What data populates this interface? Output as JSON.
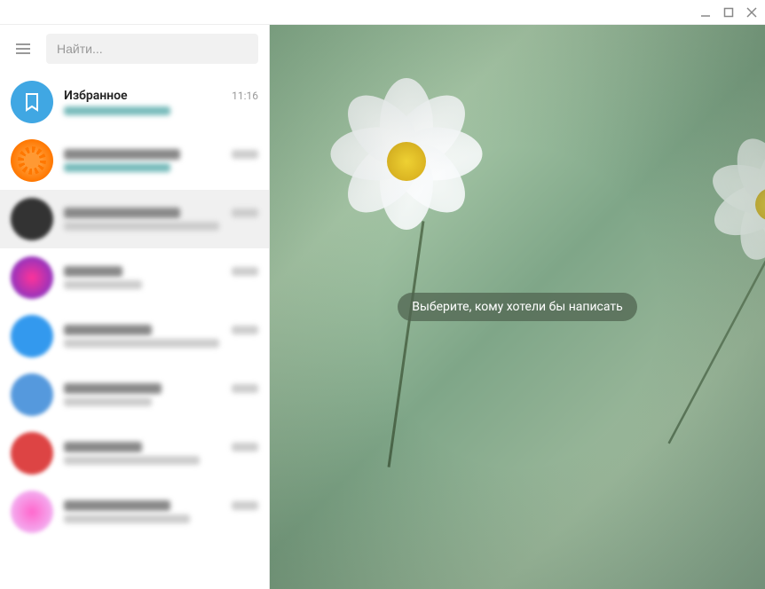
{
  "search": {
    "placeholder": "Найти..."
  },
  "chats": [
    {
      "title": "Избранное",
      "time": "11:16"
    }
  ],
  "empty_state": {
    "message": "Выберите, кому хотели бы написать"
  }
}
